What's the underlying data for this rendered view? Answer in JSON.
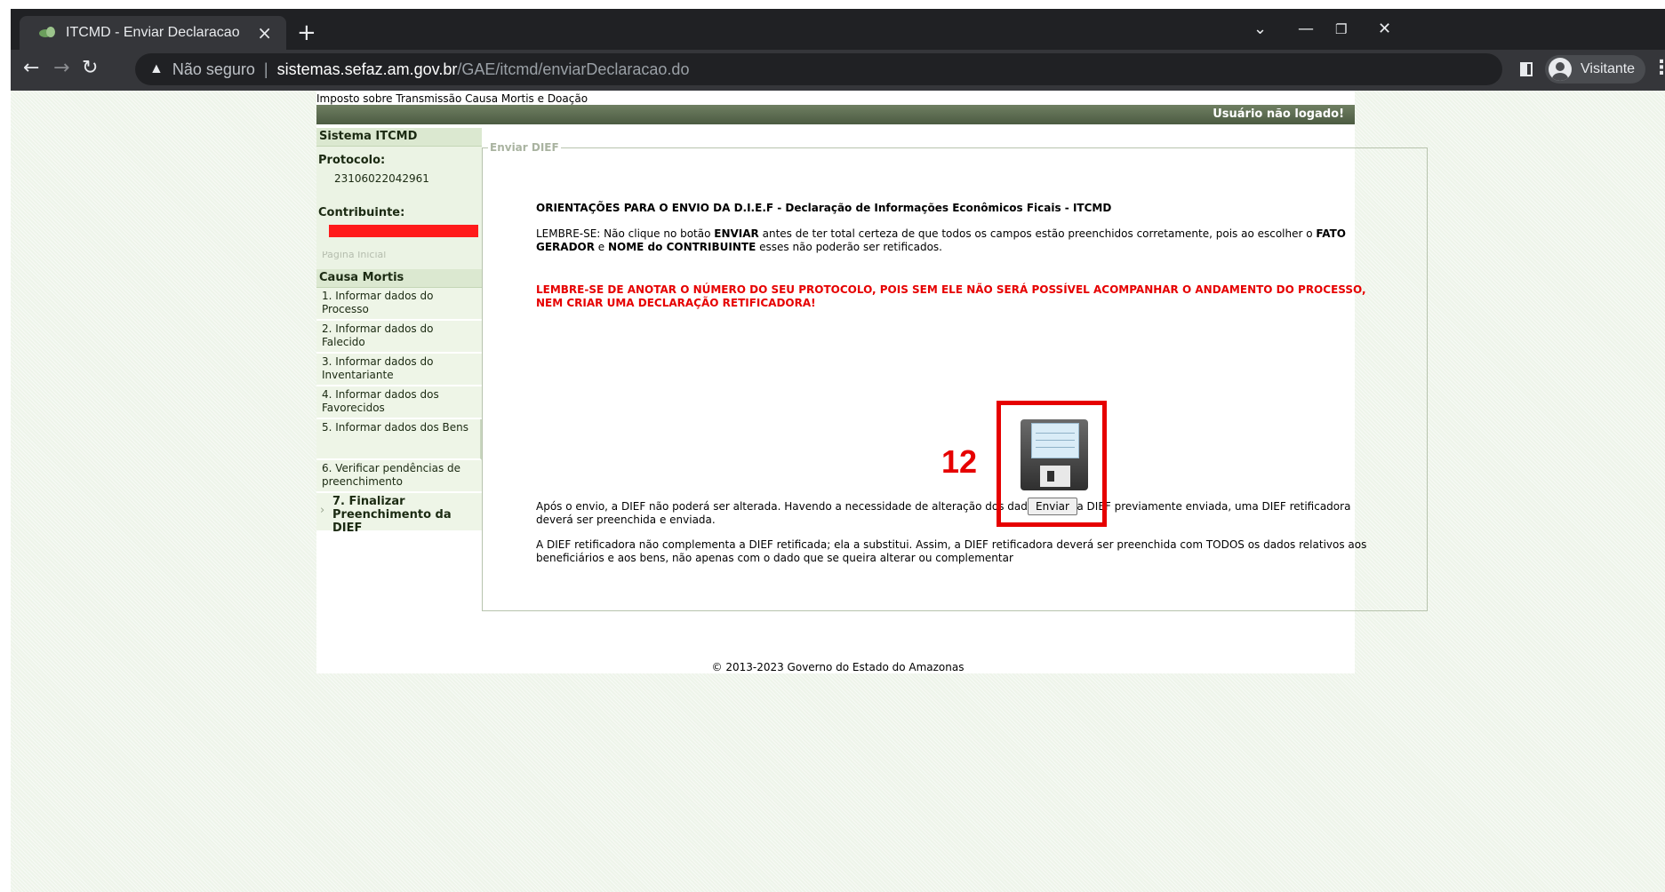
{
  "browser": {
    "tab_title": "ITCMD - Enviar Declaracao",
    "tab_close": "×",
    "new_tab": "+",
    "address": {
      "security_label": "Não seguro",
      "host": "sistemas.sefaz.am.gov.br",
      "path": "/GAE/itcmd/enviarDeclaracao.do"
    },
    "profile_label": "Visitante"
  },
  "page": {
    "site_header": "Imposto sobre Transmissão Causa Mortis e Doação",
    "user_status": "Usuário não logado!",
    "sidebar": {
      "section_title": "Sistema ITCMD",
      "protocolo_label": "Protocolo:",
      "protocolo_value": "23106022042961",
      "contribuinte_label": "Contribuinte:",
      "faded_link": "Página Inicial",
      "causa_title": "Causa Mortis",
      "items": [
        "1. Informar dados do Processo",
        "2. Informar dados do Falecido",
        "3. Informar dados do Inventariante",
        "4. Informar dados dos Favorecidos",
        "5. Informar dados dos Bens",
        "6. Verificar pendências de preenchimento",
        "7. Finalizar Preenchimento da DIEF"
      ]
    },
    "main": {
      "legend": "Enviar DIEF",
      "title": "ORIENTAÇÕES PARA O ENVIO DA D.I.E.F - Declaração de Informações Econômicos Ficais - ITCMD",
      "lembre": {
        "p1": "LEMBRE-SE: Não clique no botão ",
        "b1": "ENVIAR",
        "p2": " antes de ter total certeza de que todos os campos estão preenchidos corretamente, pois ao escolher o ",
        "b2": "FATO GERADOR",
        "p3": " e ",
        "b3": "NOME do CONTRIBUINTE",
        "p4": " esses não poderão ser retificados."
      },
      "warning": "LEMBRE-SE DE ANOTAR O NÚMERO DO SEU PROTOCOLO, POIS SEM ELE NÃO SERÁ POSSÍVEL ACOMPANHAR O ANDAMENTO DO PROCESSO, NEM CRIAR UMA DECLARAÇÃO RETIFICADORA!",
      "annotation_number": "12",
      "submit_label": "Enviar",
      "after_send_1": "Após o envio, a DIEF não poderá ser alterada. Havendo a necessidade de alteração dos dados de uma DIEF previamente enviada, uma DIEF retificadora deverá ser preenchida e enviada.",
      "after_send_2": "A DIEF retificadora não complementa a DIEF retificada; ela a substitui. Assim, a DIEF retificadora deverá ser preenchida com TODOS os dados relativos aos beneficiários e aos bens, não apenas com o dado que se queira alterar ou complementar"
    },
    "footer": "© 2013-2023 Governo do Estado do Amazonas"
  },
  "colors": {
    "annotation": "#e60000",
    "user_bar": "#4c5b42",
    "warning_text": "#e60000",
    "sidebar_bg": "#ebf3e4"
  },
  "icons": [
    "site-favicon-icon",
    "close-icon",
    "new-tab-icon",
    "back-arrow-icon",
    "forward-arrow-icon",
    "reload-icon",
    "warning-icon",
    "side-panel-icon",
    "profile-avatar-icon",
    "kebab-menu-icon",
    "floppy-disk-icon",
    "minimize-icon",
    "restore-icon",
    "window-close-icon",
    "tab-search-icon"
  ]
}
